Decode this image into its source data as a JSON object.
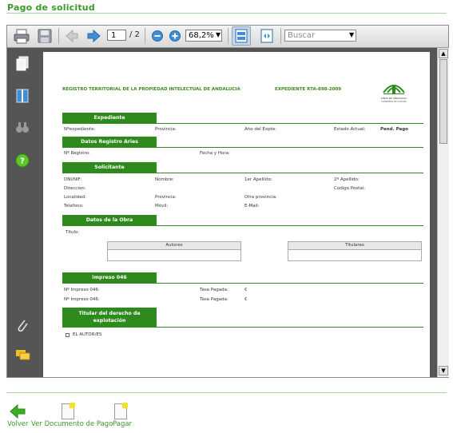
{
  "page": {
    "title": "Pago de solicitud"
  },
  "toolbar": {
    "page_current": "1",
    "page_total": "/ 2",
    "zoom": "68,2%",
    "search_placeholder": "Buscar"
  },
  "document": {
    "registry_title": "REGISTRO TERRITORIAL DE LA PROPIEDAD INTELECTUAL DE ANDALUCIA",
    "expediente_code": "EXPEDIENTE RTA-898-2009",
    "logo_text": "JUNTA DE ANDALUCIA",
    "logo_subtext": "CONSEJERIA DE CULTURA",
    "sections": {
      "expediente": "Expediente",
      "registro_aries": "Datos Registro Aries",
      "solicitante": "Solicitante",
      "obra": "Datos de la Obra",
      "impreso": "Impreso 046",
      "titular": "Titular del derecho de explotación"
    },
    "fields": {
      "n_expediente": "Nºexpediente:",
      "provincia": "Provincia:",
      "ano_expte": "Año del Expte:",
      "estado_actual": "Estado Actual:",
      "estado_val": "Pend. Pago",
      "n_registro": "Nº Registro:",
      "fecha_hora": "Fecha y Hora:",
      "dni": "DNI/NIF:",
      "nombre": "Nombre:",
      "apellido1": "1er Apellido:",
      "apellido2": "2º Apellido:",
      "direccion": "Direccion:",
      "codigo_postal": "Codigo Postal:",
      "localidad": "Localidad:",
      "provincia2": "Provincia:",
      "otra_provincia": "Otra provincia:",
      "telefono": "Telefono:",
      "movil": "Móvil:",
      "email": "E-Mail:",
      "titulo": "Título:",
      "autores": "Autores",
      "titulares": "Titulares",
      "impreso1": "Nº Impreso 046:",
      "tasa1": "Tasa Pagada:",
      "euro1": "€",
      "impreso2": "Nº Impreso 046:",
      "tasa2": "Tasa Pagada:",
      "euro2": "€",
      "el_autor": "EL AUTOR/ES"
    }
  },
  "actions": {
    "volver": "Volver",
    "ver_documento": "Ver Documento de Pago",
    "pagar": "Pagar"
  }
}
